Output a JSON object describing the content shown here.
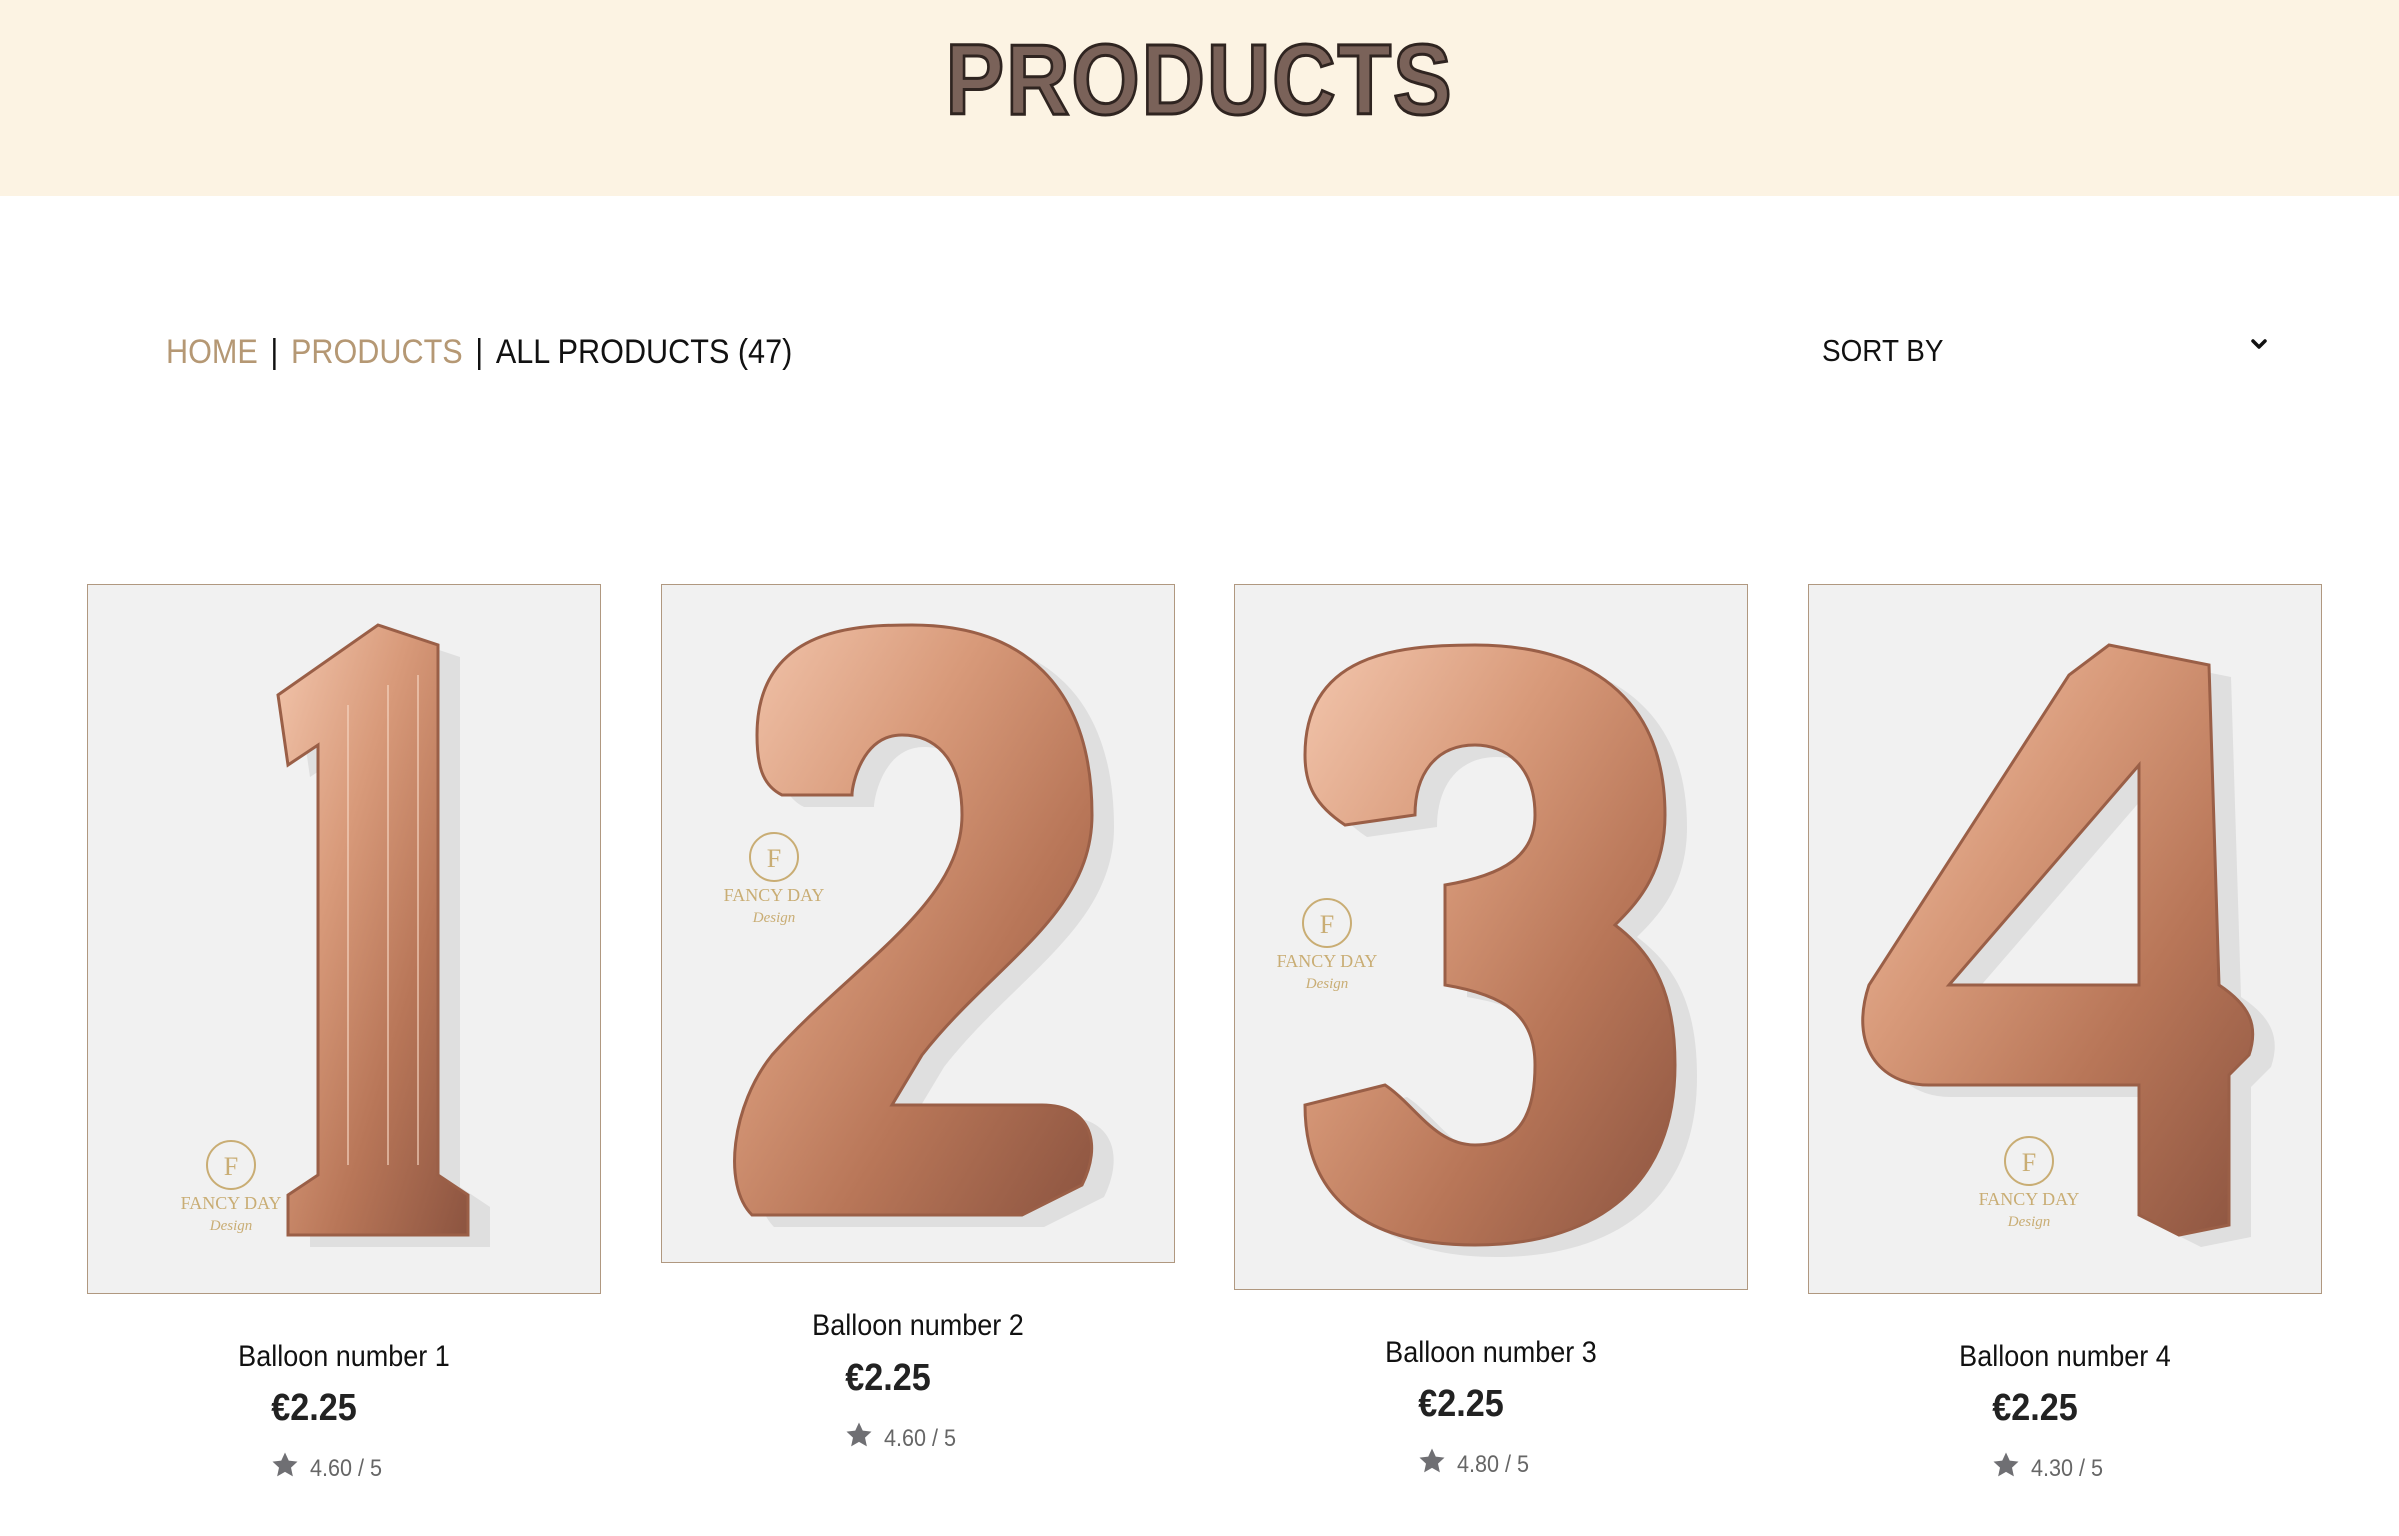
{
  "header": {
    "title": "PRODUCTS"
  },
  "breadcrumb": {
    "home": "HOME",
    "separator": "|",
    "products": "PRODUCTS",
    "current": "ALL PRODUCTS (47)"
  },
  "sort": {
    "label": "SORT BY",
    "icon": "chevron-down-icon"
  },
  "brand": {
    "logo_letter": "F",
    "name": "FANCY DAY",
    "tagline": "Design"
  },
  "colors": {
    "hero_background": "#fcf3e3",
    "title_fill": "#7a6259",
    "link": "#b59874",
    "balloon": "#c98a6c",
    "card_border": "#b09880"
  },
  "products": [
    {
      "name": "Balloon number 1",
      "digit": "1",
      "price": "€2.25",
      "rating": "4.60 / 5"
    },
    {
      "name": "Balloon number 2",
      "digit": "2",
      "price": "€2.25",
      "rating": "4.60 / 5"
    },
    {
      "name": "Balloon number 3",
      "digit": "3",
      "price": "€2.25",
      "rating": "4.80 / 5"
    },
    {
      "name": "Balloon number 4",
      "digit": "4",
      "price": "€2.25",
      "rating": "4.30 / 5"
    }
  ]
}
